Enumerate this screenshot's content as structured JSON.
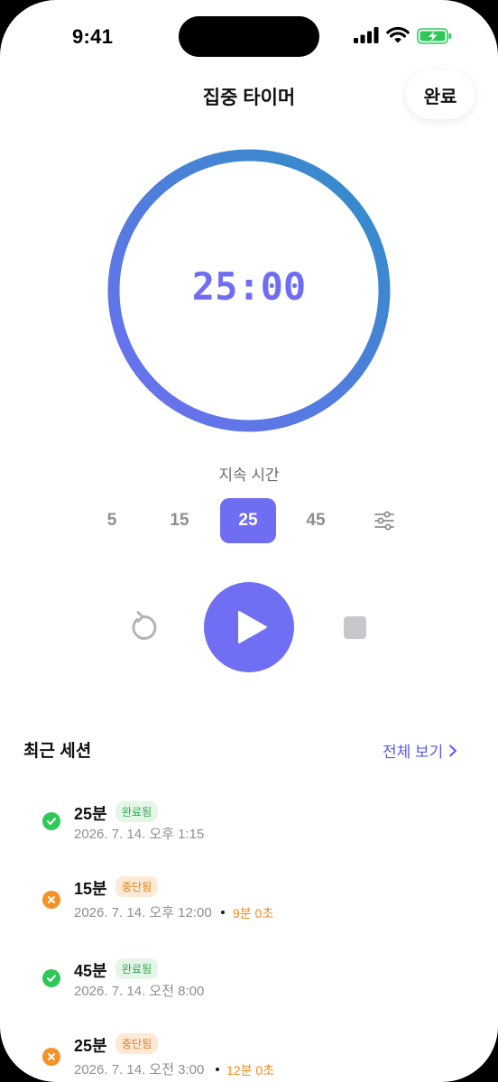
{
  "status_bar": {
    "time": "9:41"
  },
  "nav": {
    "title": "집중 타이머",
    "done_label": "완료"
  },
  "timer": {
    "display": "25:00",
    "progress": 1.0,
    "gradient_colors": [
      "#2f8fc6",
      "#6f6ef2"
    ]
  },
  "duration": {
    "label": "지속 시간",
    "options": [
      "5",
      "15",
      "25",
      "45"
    ],
    "selected": "25"
  },
  "controls": {
    "play_color": "#706ff3"
  },
  "recent": {
    "title": "최근 세션",
    "see_all": "전체 보기",
    "sessions": [
      {
        "duration": "25분",
        "status": "완료됨",
        "status_type": "completed",
        "date": "2026. 7. 14. 오후 1:15",
        "elapsed": ""
      },
      {
        "duration": "15분",
        "status": "중단됨",
        "status_type": "stopped",
        "date": "2026. 7. 14. 오후 12:00",
        "elapsed": "9분 0초"
      },
      {
        "duration": "45분",
        "status": "완료됨",
        "status_type": "completed",
        "date": "2026. 7. 14. 오전 8:00",
        "elapsed": ""
      },
      {
        "duration": "25분",
        "status": "중단됨",
        "status_type": "stopped",
        "date": "2026. 7. 14. 오전 3:00",
        "elapsed": "12분 0초"
      }
    ]
  }
}
